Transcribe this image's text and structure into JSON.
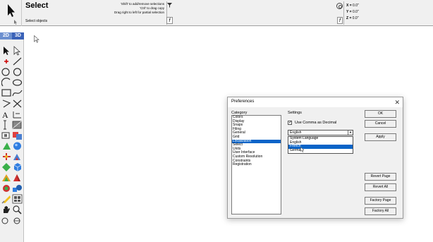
{
  "top_bar": {
    "tool_name": "Select",
    "tool_hint": "Select objects",
    "tips": [
      "'Shift' to add/remove selections",
      "'Ctrl' to drag copy",
      "Drag right to left for partial selection"
    ],
    "fx_label": "f",
    "coords": {
      "x_label": "X =",
      "x_value": "0.0\"",
      "y_label": "Y =",
      "y_value": "0.0\"",
      "z_label": "Z =",
      "z_value": "0.0\""
    }
  },
  "toolbox": {
    "tab_2d": "2D",
    "tab_3d": "3D",
    "tab_colors": {
      "active": "#3a62b8",
      "inactive": "#6b8fcf"
    }
  },
  "dialog": {
    "title": "Preferences",
    "close_glyph": "✕",
    "category_label": "Category",
    "categories": [
      "Colors",
      "Display",
      "Snaps",
      "Filing",
      "General",
      "Grid",
      "Localization",
      "Select",
      "Units",
      "User Interface",
      "Custom Resolution",
      "Constraints",
      "Registration"
    ],
    "selected_category": "Localization",
    "settings_label": "Settings",
    "checkbox_label": "Use Comma as Decimal",
    "checkbox_checked": true,
    "language_select_value": "English",
    "language_options": [
      "System Language",
      "English",
      "French",
      "German"
    ],
    "highlighted_option": "French",
    "buttons": {
      "ok": "OK",
      "cancel": "Cancel",
      "apply": "Apply",
      "revert_page": "Revert Page",
      "revert_all": "Revert All",
      "factory_page": "Factory Page",
      "factory_all": "Factory All"
    },
    "highlight_color": "#0a64c8"
  }
}
